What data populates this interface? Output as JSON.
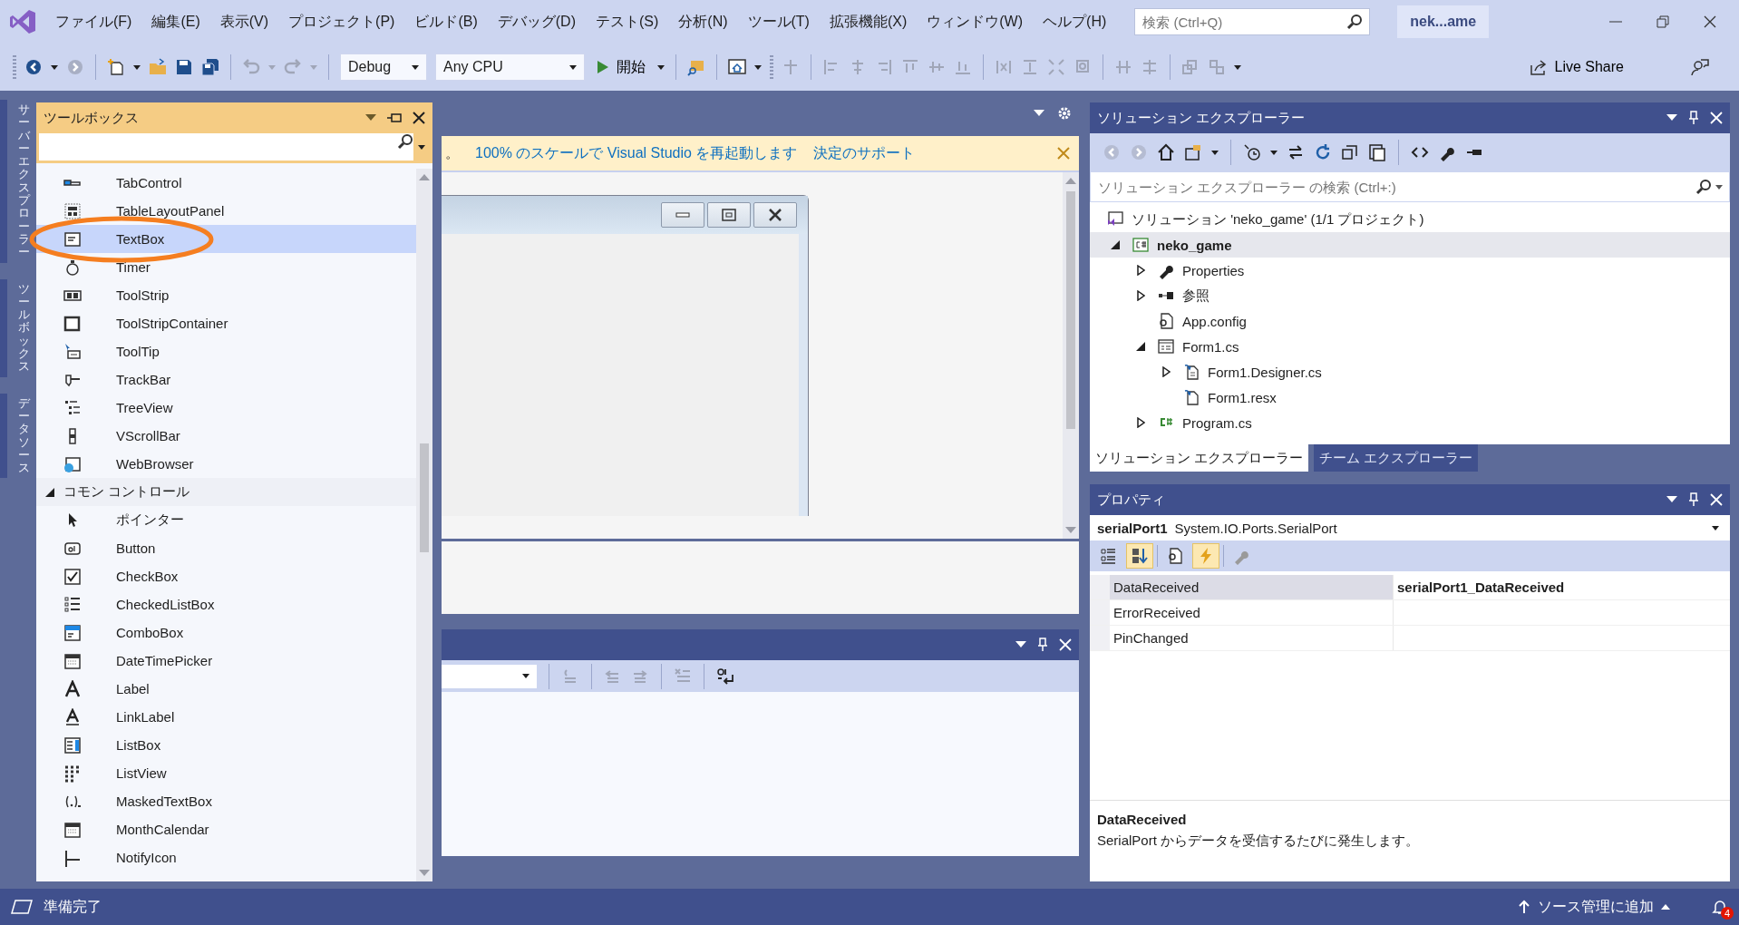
{
  "menu": [
    "ファイル(F)",
    "編集(E)",
    "表示(V)",
    "プロジェクト(P)",
    "ビルド(B)",
    "デバッグ(D)",
    "テスト(S)",
    "分析(N)",
    "ツール(T)",
    "拡張機能(X)",
    "ウィンドウ(W)",
    "ヘルプ(H)"
  ],
  "search": {
    "placeholder": "検索 (Ctrl+Q)"
  },
  "solution_badge": "nek...ame",
  "toolbar": {
    "configuration": "Debug",
    "platform": "Any CPU",
    "start_button": "開始",
    "live_share": "Live Share"
  },
  "side_tabs": [
    "サーバーエクスプローラー",
    "ツールボックス",
    "データソース"
  ],
  "toolbox": {
    "title": "ツールボックス",
    "items": [
      {
        "kind": "item",
        "label": "TabControl",
        "selected": false
      },
      {
        "kind": "item",
        "label": "TableLayoutPanel",
        "selected": false
      },
      {
        "kind": "item",
        "label": "TextBox",
        "selected": true
      },
      {
        "kind": "item",
        "label": "Timer",
        "selected": false
      },
      {
        "kind": "item",
        "label": "ToolStrip",
        "selected": false
      },
      {
        "kind": "item",
        "label": "ToolStripContainer",
        "selected": false
      },
      {
        "kind": "item",
        "label": "ToolTip",
        "selected": false
      },
      {
        "kind": "item",
        "label": "TrackBar",
        "selected": false
      },
      {
        "kind": "item",
        "label": "TreeView",
        "selected": false
      },
      {
        "kind": "item",
        "label": "VScrollBar",
        "selected": false
      },
      {
        "kind": "item",
        "label": "WebBrowser",
        "selected": false
      },
      {
        "kind": "group",
        "label": "コモン コントロール",
        "expanded": true
      },
      {
        "kind": "item",
        "label": "ポインター",
        "selected": false
      },
      {
        "kind": "item",
        "label": "Button",
        "selected": false
      },
      {
        "kind": "item",
        "label": "CheckBox",
        "selected": false
      },
      {
        "kind": "item",
        "label": "CheckedListBox",
        "selected": false
      },
      {
        "kind": "item",
        "label": "ComboBox",
        "selected": false
      },
      {
        "kind": "item",
        "label": "DateTimePicker",
        "selected": false
      },
      {
        "kind": "item",
        "label": "Label",
        "selected": false
      },
      {
        "kind": "item",
        "label": "LinkLabel",
        "selected": false
      },
      {
        "kind": "item",
        "label": "ListBox",
        "selected": false
      },
      {
        "kind": "item",
        "label": "ListView",
        "selected": false
      },
      {
        "kind": "item",
        "label": "MaskedTextBox",
        "selected": false
      },
      {
        "kind": "item",
        "label": "MonthCalendar",
        "selected": false
      },
      {
        "kind": "item",
        "label": "NotifyIcon",
        "selected": false
      }
    ]
  },
  "info_bar": {
    "prefix": "。",
    "restart_link": "100% のスケールで Visual Studio を再起動します",
    "help_link": "決定のサポート"
  },
  "solution_explorer": {
    "title": "ソリューション エクスプローラー",
    "search_placeholder": "ソリューション エクスプローラー の検索 (Ctrl+:)",
    "tree": [
      {
        "kind": "solution",
        "label": "ソリューション 'neko_game' (1/1 プロジェクト)",
        "selected": false,
        "children": [
          {
            "kind": "project",
            "label": "neko_game",
            "selected": true,
            "expanded": true,
            "children": [
              {
                "kind": "properties",
                "label": "Properties",
                "selected": false,
                "expanded": false
              },
              {
                "kind": "references",
                "label": "参照",
                "selected": false,
                "expanded": false
              },
              {
                "kind": "config",
                "label": "App.config",
                "selected": false
              },
              {
                "kind": "form",
                "label": "Form1.cs",
                "selected": false,
                "expanded": true,
                "children": [
                  {
                    "kind": "designer",
                    "label": "Form1.Designer.cs",
                    "selected": false,
                    "expanded": false
                  },
                  {
                    "kind": "resx",
                    "label": "Form1.resx",
                    "selected": false
                  }
                ]
              },
              {
                "kind": "csharp",
                "label": "Program.cs",
                "selected": false,
                "expanded": false
              }
            ]
          }
        ]
      }
    ],
    "tabs": [
      {
        "label": "ソリューション エクスプローラー",
        "selected": true
      },
      {
        "label": "チーム エクスプローラー",
        "selected": false
      }
    ]
  },
  "properties": {
    "title": "プロパティ",
    "object_name": "serialPort1",
    "object_type": "System.IO.Ports.SerialPort",
    "toolbar": [
      {
        "kind": "categorized",
        "selected": false
      },
      {
        "kind": "alphabetical",
        "selected": true
      },
      {
        "kind": "property_pages",
        "selected": false
      },
      {
        "kind": "events",
        "selected": true
      },
      {
        "kind": "settings",
        "selected": false
      }
    ],
    "rows": [
      {
        "name": "DataReceived",
        "value": "serialPort1_DataReceived",
        "selected": true
      },
      {
        "name": "ErrorReceived",
        "selected": false
      },
      {
        "name": "PinChanged",
        "selected": false
      }
    ],
    "description_title": "DataReceived",
    "description": "SerialPort からデータを受信するたびに発生します。"
  },
  "status_bar": {
    "text": "準備完了",
    "source_control": "ソース管理に追加",
    "notifications": "4"
  }
}
